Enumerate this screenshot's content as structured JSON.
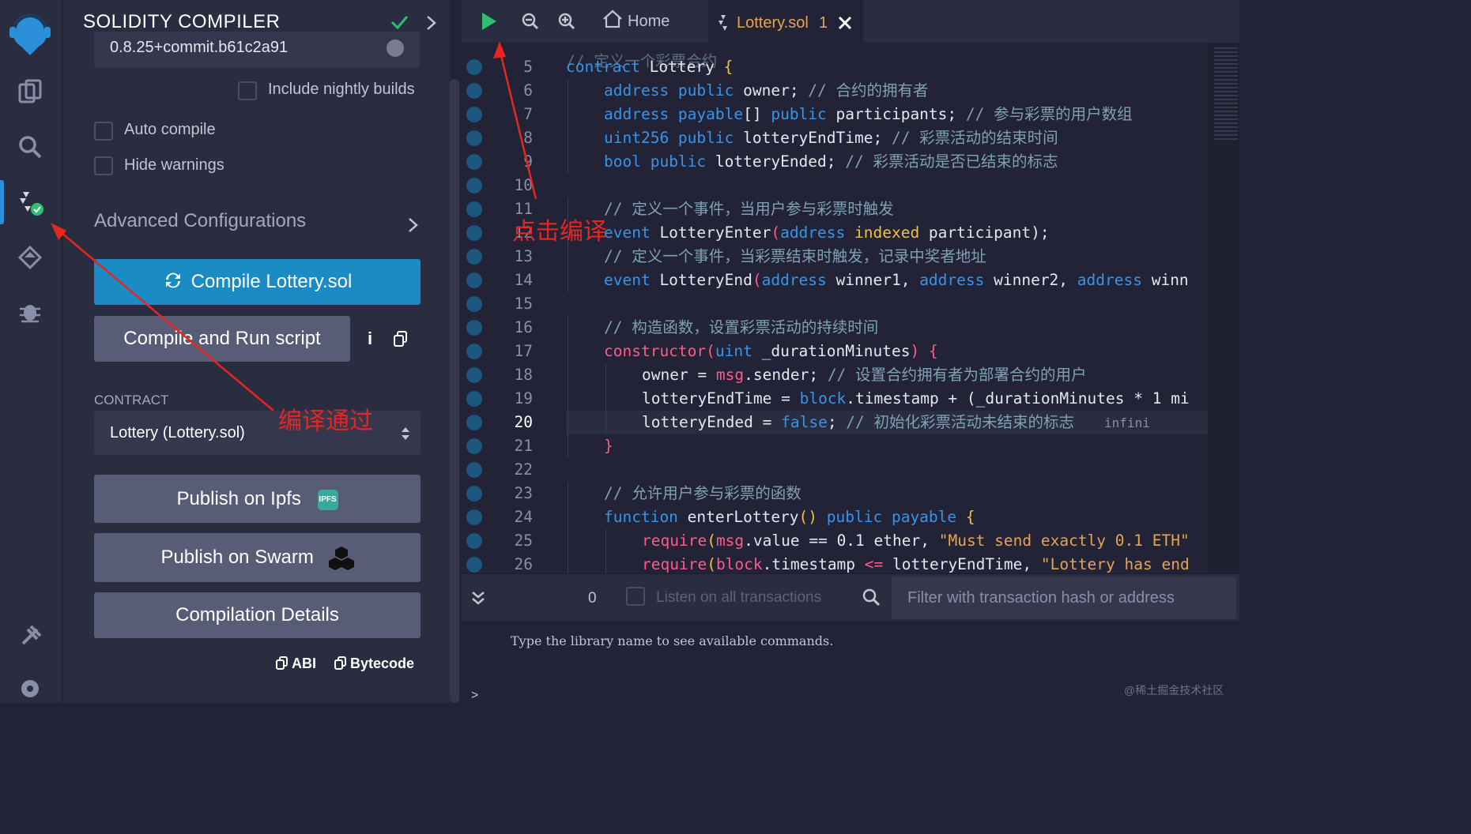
{
  "sidebar": {
    "title": "SOLIDITY COMPILER",
    "compiler_version": "0.8.25+commit.b61c2a91",
    "include_nightly_label": "Include nightly builds",
    "auto_compile_label": "Auto compile",
    "hide_warnings_label": "Hide warnings",
    "advanced_config_label": "Advanced Configurations",
    "compile_button": "Compile Lottery.sol",
    "compile_run_button": "Compile and Run script",
    "info_icon": "i",
    "contract_label": "CONTRACT",
    "contract_value": "Lottery (Lottery.sol)",
    "publish_ipfs": "Publish on Ipfs",
    "ipfs_badge": "IPFS",
    "publish_swarm": "Publish on Swarm",
    "compilation_details": "Compilation Details",
    "abi_label": "ABI",
    "bytecode_label": "Bytecode"
  },
  "tabs": {
    "home": "Home",
    "file": "Lottery.sol",
    "file_count": "1"
  },
  "editor": {
    "first_line_fragment": "// 定义一个彩票合约",
    "lines": [
      {
        "n": "5"
      },
      {
        "n": "6"
      },
      {
        "n": "7"
      },
      {
        "n": "8"
      },
      {
        "n": "9"
      },
      {
        "n": "10"
      },
      {
        "n": "11"
      },
      {
        "n": "12"
      },
      {
        "n": "13"
      },
      {
        "n": "14"
      },
      {
        "n": "15"
      },
      {
        "n": "16"
      },
      {
        "n": "17"
      },
      {
        "n": "18"
      },
      {
        "n": "19"
      },
      {
        "n": "20"
      },
      {
        "n": "21"
      },
      {
        "n": "22"
      },
      {
        "n": "23"
      },
      {
        "n": "24"
      },
      {
        "n": "25"
      },
      {
        "n": "26"
      }
    ],
    "code": {
      "l5_kw": "contract",
      "l5_name": " Lottery ",
      "l5_brace": "{",
      "l6_a": "address",
      "l6_b": " public",
      "l6_c": " owner;",
      "l6_cm": " // 合约的拥有者",
      "l7_a": "address",
      "l7_b": " payable",
      "l7_c": "[]",
      "l7_d": " public",
      "l7_e": " participants;",
      "l7_cm": " // 参与彩票的用户数组",
      "l8_a": "uint256",
      "l8_b": " public",
      "l8_c": " lotteryEndTime;",
      "l8_cm": " // 彩票活动的结束时间",
      "l9_a": "bool",
      "l9_b": " public",
      "l9_c": " lotteryEnded;",
      "l9_cm": " // 彩票活动是否已结束的标志",
      "l11_cm": "// 定义一个事件，当用户参与彩票时触发",
      "l12_a": "event",
      "l12_b": " LotteryEnter",
      "l12_c": "(",
      "l12_d": "address",
      "l12_e": " indexed",
      "l12_f": " participant",
      "l12_g": ");",
      "l13_cm": "// 定义一个事件，当彩票结束时触发，记录中奖者地址",
      "l14_a": "event",
      "l14_b": " LotteryEnd",
      "l14_c": "(",
      "l14_d": "address",
      "l14_e": " winner1, ",
      "l14_f": "address",
      "l14_g": " winner2, ",
      "l14_h": "address",
      "l14_i": " winn",
      "l16_cm": "// 构造函数，设置彩票活动的持续时间",
      "l17_a": "constructor",
      "l17_b": "(",
      "l17_c": "uint",
      "l17_d": " _durationMinutes",
      "l17_e": ") ",
      "l17_f": "{",
      "l18_a": "owner = ",
      "l18_b": "msg",
      "l18_c": ".sender;",
      "l18_cm": " // 设置合约拥有者为部署合约的用户",
      "l19_a": "lotteryEndTime = ",
      "l19_b": "block",
      "l19_c": ".timestamp + (_durationMinutes * 1 mi",
      "l20_a": "lotteryEnded = ",
      "l20_b": "false",
      "l20_c": ";",
      "l20_cm": " // 初始化彩票活动未结束的标志",
      "l20_gas": "infini",
      "l21_a": "}",
      "l23_cm": "// 允许用户参与彩票的函数",
      "l24_a": "function",
      "l24_b": " enterLottery",
      "l24_c": "()",
      "l24_d": " public",
      "l24_e": " payable",
      "l24_f": " {",
      "l25_a": "require",
      "l25_b": "(",
      "l25_c": "msg",
      "l25_d": ".value == 0.1 ether, ",
      "l25_e": "\"Must send exactly 0.1 ETH\"",
      "l26_a": "require",
      "l26_b": "(",
      "l26_c": "block",
      "l26_d": ".timestamp ",
      "l26_e": "<=",
      "l26_f": " lotteryEndTime, ",
      "l26_g": "\"Lottery has end"
    }
  },
  "terminal": {
    "count": "0",
    "listen_label": "Listen on all transactions",
    "filter_placeholder": "Filter with transaction hash or address",
    "output": "Type the library name to see available commands.",
    "prompt": ">"
  },
  "annotations": {
    "click_compile": "点击编译",
    "compile_passed": "编译通过",
    "watermark": "@稀土掘金技术社区"
  },
  "colors": {
    "accent": "#1a8bc3",
    "annotation": "#e6261f",
    "run": "#2fbf71"
  }
}
